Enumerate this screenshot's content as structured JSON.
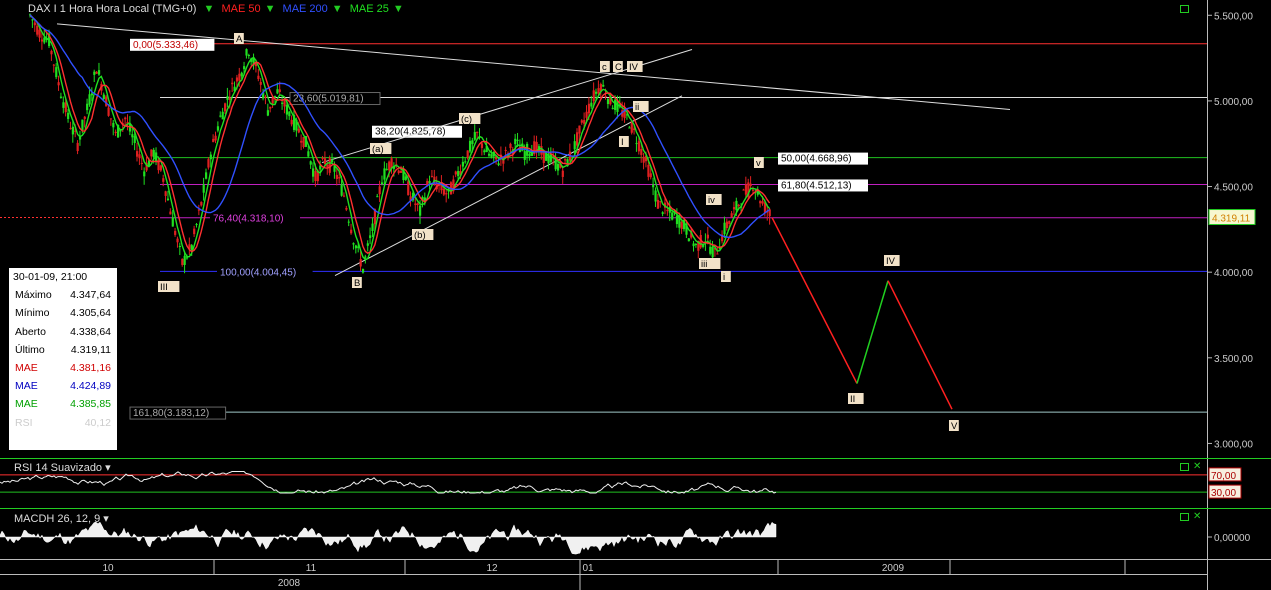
{
  "header": {
    "instrument": "DAX I 1 Hora Hora Local (TMG+0)",
    "indicators": [
      {
        "label": "MAE 50",
        "color": "#ff2020"
      },
      {
        "label": "MAE 200",
        "color": "#3050ff"
      },
      {
        "label": "MAE 25",
        "color": "#20e020"
      }
    ]
  },
  "info_box": {
    "datetime": "30-01-09, 21:00",
    "rows": [
      {
        "label": "Máximo",
        "value": "4.347,64",
        "color": "#000000"
      },
      {
        "label": "Mínimo",
        "value": "4.305,64",
        "color": "#000000"
      },
      {
        "label": "Aberto",
        "value": "4.338,64",
        "color": "#000000"
      },
      {
        "label": "Último",
        "value": "4.319,11",
        "color": "#000000"
      },
      {
        "label": "MAE",
        "value": "4.381,16",
        "color": "#d00000"
      },
      {
        "label": "MAE",
        "value": "4.424,89",
        "color": "#0000c0"
      },
      {
        "label": "MAE",
        "value": "4.385,85",
        "color": "#00a000"
      },
      {
        "label": "RSI",
        "value": "40,12",
        "color": "#cccccc"
      }
    ]
  },
  "rsi_panel": {
    "title": "RSI 14 Suavizado",
    "upper": "70,00",
    "lower": "30,00"
  },
  "macd_panel": {
    "title": "MACDH 26, 12, 9",
    "zero": "0,00000"
  },
  "chart_data": {
    "type": "candlestick",
    "y_ticks": [
      "5.500,00",
      "5.000,00",
      "4.500,00",
      "4.000,00",
      "3.500,00",
      "3.000,00"
    ],
    "y_tick_values": [
      5500,
      5000,
      4500,
      4000,
      3500,
      3000
    ],
    "ylim": [
      2950,
      5560
    ],
    "last_price": "4.319,11",
    "x_month_labels": [
      "10",
      "11",
      "12",
      "01",
      "2009"
    ],
    "x_year_labels": [
      "2008",
      "2009"
    ],
    "series": [
      {
        "name": "MAE 50",
        "color": "#ff2020"
      },
      {
        "name": "MAE 200",
        "color": "#3050ff"
      },
      {
        "name": "MAE 25",
        "color": "#20e020"
      }
    ],
    "price_path": [
      5500,
      5400,
      5350,
      5100,
      4900,
      4750,
      4950,
      5200,
      5000,
      4800,
      4900,
      4750,
      4600,
      4700,
      4550,
      4300,
      4050,
      4150,
      4400,
      4700,
      4900,
      5050,
      5150,
      5300,
      5150,
      4950,
      5050,
      4950,
      4850,
      4750,
      4550,
      4650,
      4600,
      4450,
      4200,
      4020,
      4250,
      4550,
      4650,
      4600,
      4450,
      4350,
      4550,
      4500,
      4450,
      4580,
      4700,
      4800,
      4700,
      4650,
      4680,
      4750,
      4700,
      4730,
      4680,
      4650,
      4600,
      4700,
      4850,
      5000,
      5100,
      5000,
      4950,
      4880,
      4750,
      4600,
      4400,
      4350,
      4320,
      4250,
      4150,
      4200,
      4100,
      4250,
      4350,
      4450,
      4520,
      4400,
      4319
    ],
    "fib_levels": [
      {
        "label": "0,00(5.333,46)",
        "value": 5333.46,
        "color": "#ff3030",
        "label_style": "red-on-white"
      },
      {
        "label": "23,60(5.019,81)",
        "value": 5019.81,
        "color": "#dcdcdc",
        "label_style": "grey-on-black"
      },
      {
        "label": "38,20(4.825,78)",
        "value": 4825.78,
        "color": "#000000",
        "label_style": "black-on-white"
      },
      {
        "label": "50,00(4.668,96)",
        "value": 4668.96,
        "color": "#20c020",
        "label_style": "black-on-white"
      },
      {
        "label": "61,80(4.512,13)",
        "value": 4512.13,
        "color": "#c020c0",
        "label_style": "black-on-white"
      },
      {
        "label": "76,40(4.318,10)",
        "value": 4318.1,
        "color": "#c020c0",
        "label_style": "magenta-on-black"
      },
      {
        "label": "100,00(4.004,45)",
        "value": 4004.45,
        "color": "#3030ff",
        "label_style": "blue-on-black"
      },
      {
        "label": "161,80(3.183,12)",
        "value": 3183.12,
        "color": "#a0c8c8",
        "label_style": "grey-on-black"
      }
    ],
    "wave_labels": [
      "A",
      "B",
      "C",
      "III",
      "(a)",
      "(b)",
      "(c)",
      "IV",
      "i",
      "ii",
      "iii",
      "iv",
      "v",
      "II",
      "IV",
      "V",
      "c",
      "I"
    ],
    "projection": [
      {
        "point": "start",
        "value": 4319
      },
      {
        "point": "III",
        "value": 3350
      },
      {
        "point": "IV",
        "value": 3950
      },
      {
        "point": "V",
        "value": 3200
      }
    ]
  }
}
